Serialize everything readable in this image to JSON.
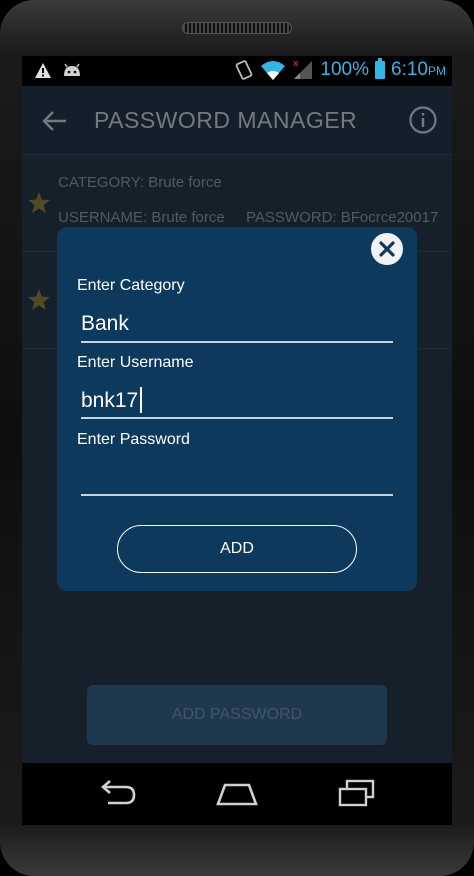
{
  "status_bar": {
    "battery_percent": "100%",
    "time": "6:10",
    "ampm": "PM",
    "icons": [
      "warning-icon",
      "android-icon",
      "vibrate-icon",
      "wifi-icon",
      "signal-icon",
      "battery-icon"
    ]
  },
  "app_bar": {
    "title": "PASSWORD MANAGER",
    "back_icon": "arrow-back-icon",
    "info_icon": "info-icon"
  },
  "list": {
    "items": [
      {
        "category": "CATEGORY: Brute force",
        "username": "USERNAME: Brute force",
        "password": "PASSWORD:  BFocrce20017",
        "icon": "star-icon"
      },
      {
        "category": "",
        "username": "",
        "password": "",
        "icon": "star-icon"
      }
    ]
  },
  "add_password_button": "ADD PASSWORD",
  "dialog": {
    "category_label": "Enter Category",
    "category_value": "Bank",
    "username_label": "Enter Username",
    "username_value": "bnk17",
    "password_label": "Enter Password",
    "password_value": "",
    "add_label": "ADD",
    "close_icon": "close-icon"
  },
  "nav_bar": {
    "icons": [
      "back-nav-icon",
      "home-nav-icon",
      "recents-nav-icon"
    ]
  },
  "colors": {
    "accent": "#33b5e5",
    "background": "#1e2c3a",
    "dialog": "#0d3a5c",
    "star": "#8a7a2a"
  }
}
